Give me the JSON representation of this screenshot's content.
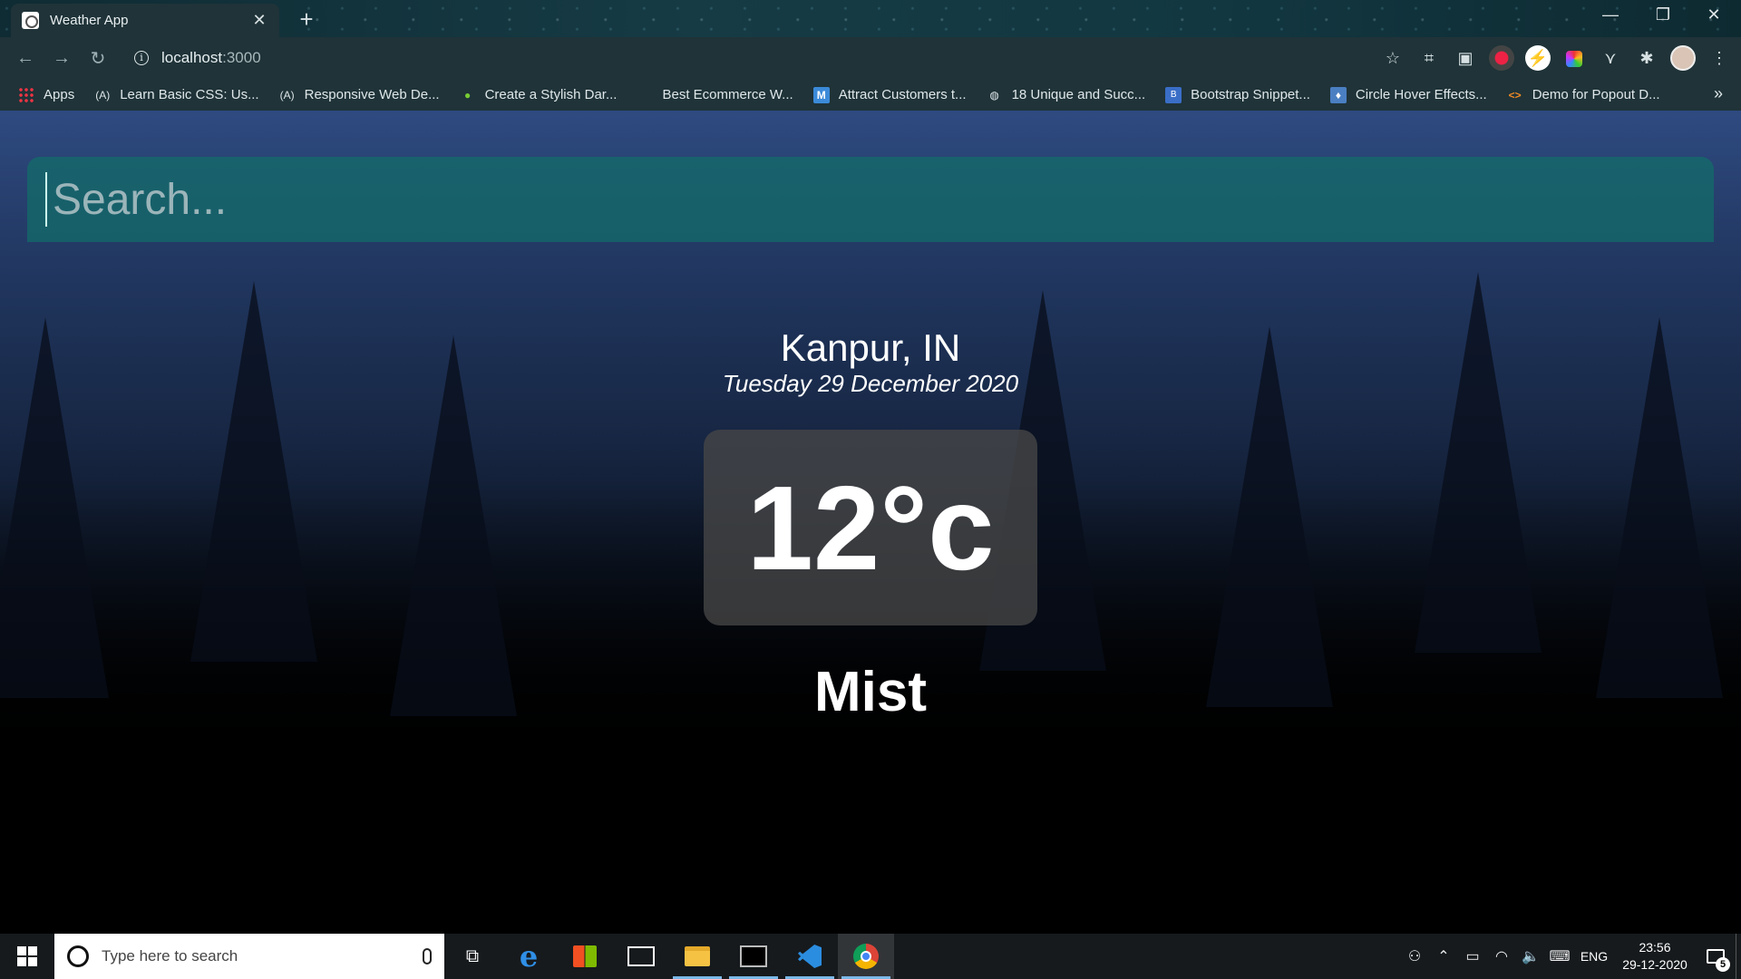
{
  "browser": {
    "tab_title": "Weather App",
    "tab_close": "✕",
    "new_tab": "+",
    "window_controls": {
      "minimize": "—",
      "restore": "❐",
      "close": "✕"
    },
    "nav": {
      "back": "←",
      "forward": "→",
      "reload": "↻"
    },
    "url_host": "localhost",
    "url_port": ":3000",
    "bookmarks": [
      {
        "label": "Apps",
        "icon": "apps-grid-icon"
      },
      {
        "label": "Learn Basic CSS: Us...",
        "icon": "fcc-icon"
      },
      {
        "label": "Responsive Web De...",
        "icon": "fcc-icon"
      },
      {
        "label": "Create a Stylish Dar...",
        "icon": "leaf-icon"
      },
      {
        "label": "Best Ecommerce W...",
        "icon": "page-icon"
      },
      {
        "label": "Attract Customers t...",
        "icon": "m-icon"
      },
      {
        "label": "18 Unique and Succ...",
        "icon": "globe-icon"
      },
      {
        "label": "Bootstrap Snippet...",
        "icon": "b-icon"
      },
      {
        "label": "Circle Hover Effects...",
        "icon": "drop-icon"
      },
      {
        "label": "Demo for Popout D...",
        "icon": "code-icon"
      }
    ],
    "bookmarks_more": "»"
  },
  "app": {
    "search_placeholder": "Search...",
    "location": "Kanpur, IN",
    "date": "Tuesday 29 December 2020",
    "temperature": "12°c",
    "condition": "Mist"
  },
  "taskbar": {
    "search_placeholder": "Type here to search",
    "apps": [
      "task-view",
      "edge",
      "store",
      "mail",
      "file-explorer",
      "terminal",
      "vscode",
      "chrome"
    ],
    "language": "ENG",
    "time": "23:56",
    "date": "29-12-2020",
    "notification_count": "5"
  }
}
